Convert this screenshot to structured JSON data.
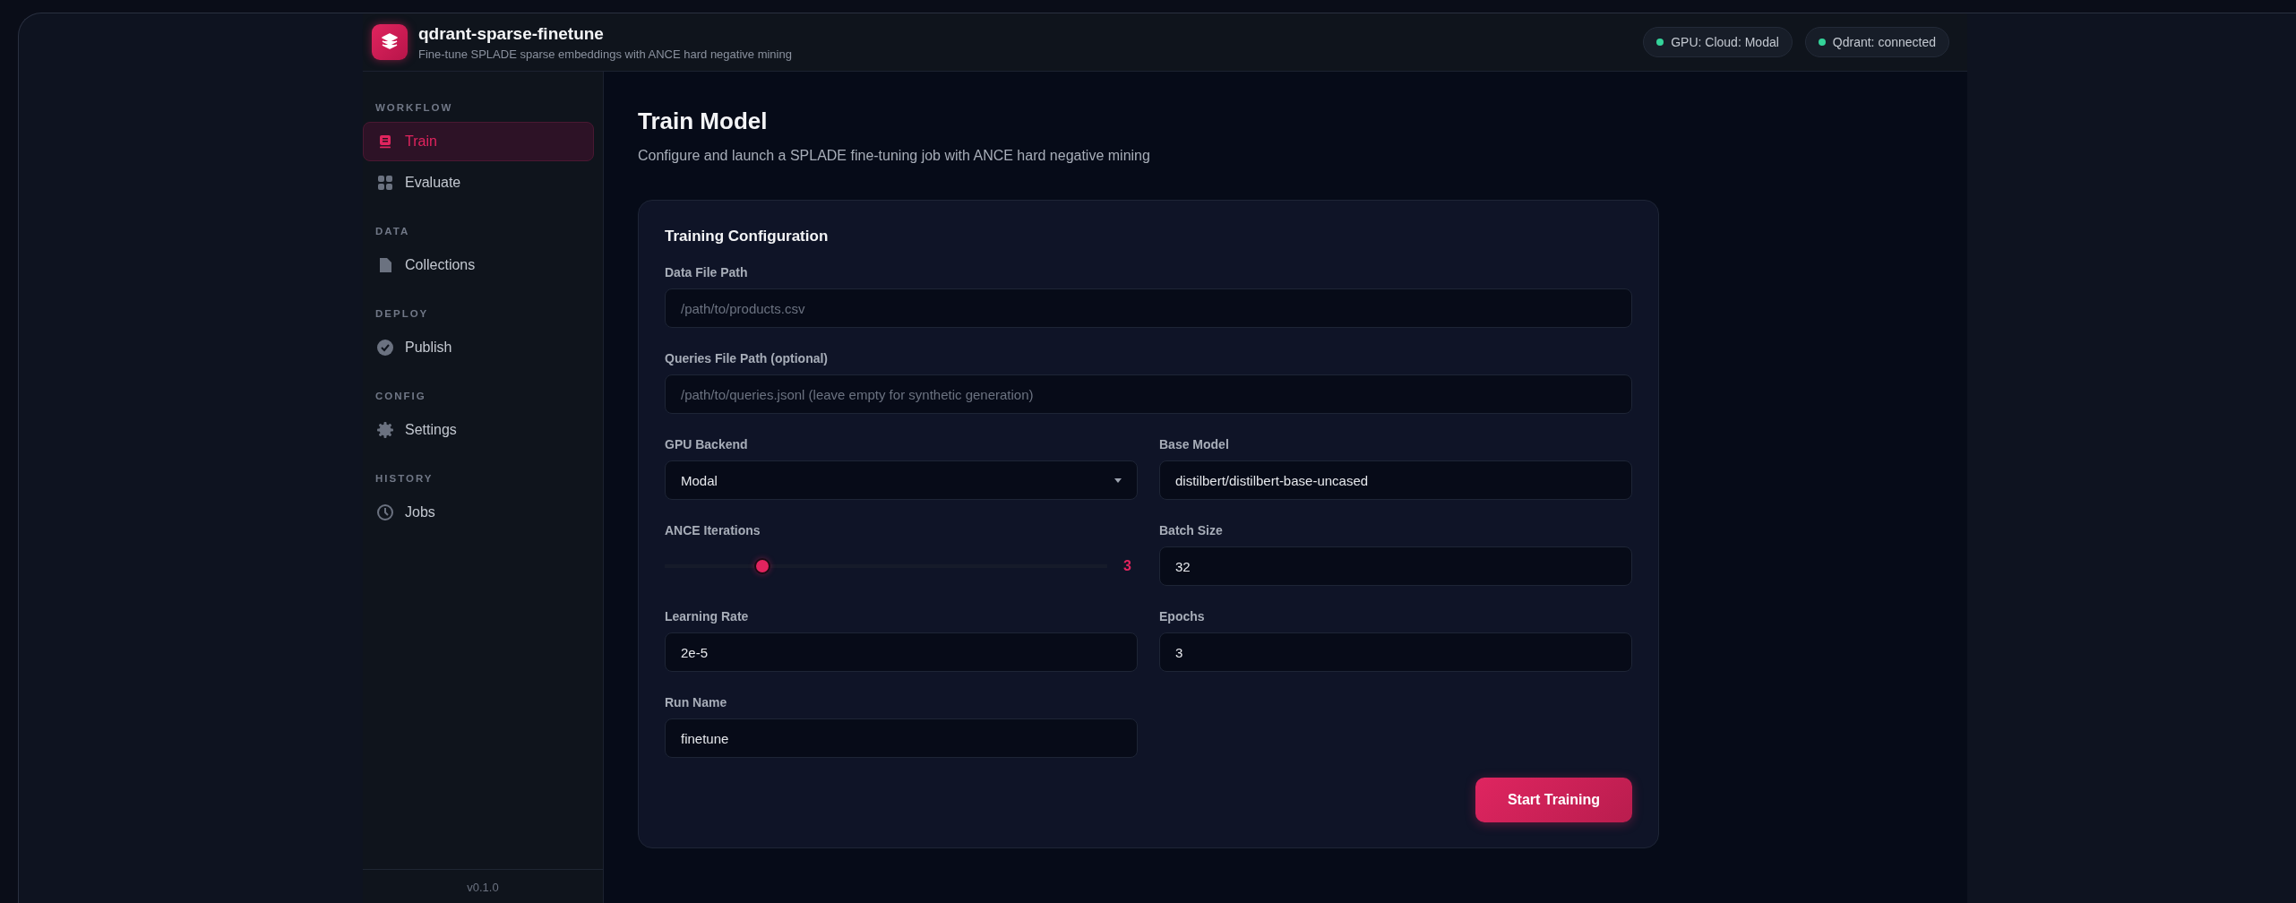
{
  "header": {
    "title": "qdrant-sparse-finetune",
    "subtitle": "Fine-tune SPLADE sparse embeddings with ANCE hard negative mining",
    "badges": [
      {
        "label": "GPU: Cloud: Modal",
        "color": "#34d399"
      },
      {
        "label": "Qdrant: connected",
        "color": "#34d399"
      }
    ]
  },
  "sidebar": {
    "sections": [
      {
        "title": "WORKFLOW",
        "items": [
          {
            "label": "Train",
            "selected": true
          },
          {
            "label": "Evaluate",
            "selected": false
          }
        ]
      },
      {
        "title": "DATA",
        "items": [
          {
            "label": "Collections",
            "selected": false
          }
        ]
      },
      {
        "title": "DEPLOY",
        "items": [
          {
            "label": "Publish",
            "selected": false
          }
        ]
      },
      {
        "title": "CONFIG",
        "items": [
          {
            "label": "Settings",
            "selected": false
          }
        ]
      },
      {
        "title": "HISTORY",
        "items": [
          {
            "label": "Jobs",
            "selected": false
          }
        ]
      }
    ],
    "version": "v0.1.0"
  },
  "page": {
    "title": "Train Model",
    "subtitle": "Configure and launch a SPLADE fine-tuning job with ANCE hard negative mining"
  },
  "card": {
    "title": "Training Configuration",
    "fields": [
      {
        "kind": "text",
        "label": "Data File Path",
        "placeholder": "/path/to/products.csv"
      },
      {
        "kind": "text",
        "label": "Queries File Path (optional)",
        "placeholder": "/path/to/queries.jsonl (leave empty for synthetic generation)"
      },
      {
        "kind": "select",
        "label": "GPU Backend",
        "value": "Modal"
      },
      {
        "kind": "text",
        "label": "Base Model",
        "value": "distilbert/distilbert-base-uncased"
      },
      {
        "kind": "slider",
        "label": "ANCE Iterations",
        "level": 0.22,
        "reading": "3"
      },
      {
        "kind": "text",
        "label": "Batch Size",
        "value": "32"
      },
      {
        "kind": "text",
        "label": "Learning Rate",
        "value": "2e-5"
      },
      {
        "kind": "text",
        "label": "Epochs",
        "value": "3"
      },
      {
        "kind": "text",
        "label": "Run Name",
        "value": "finetune"
      }
    ],
    "button": "Start Training"
  }
}
